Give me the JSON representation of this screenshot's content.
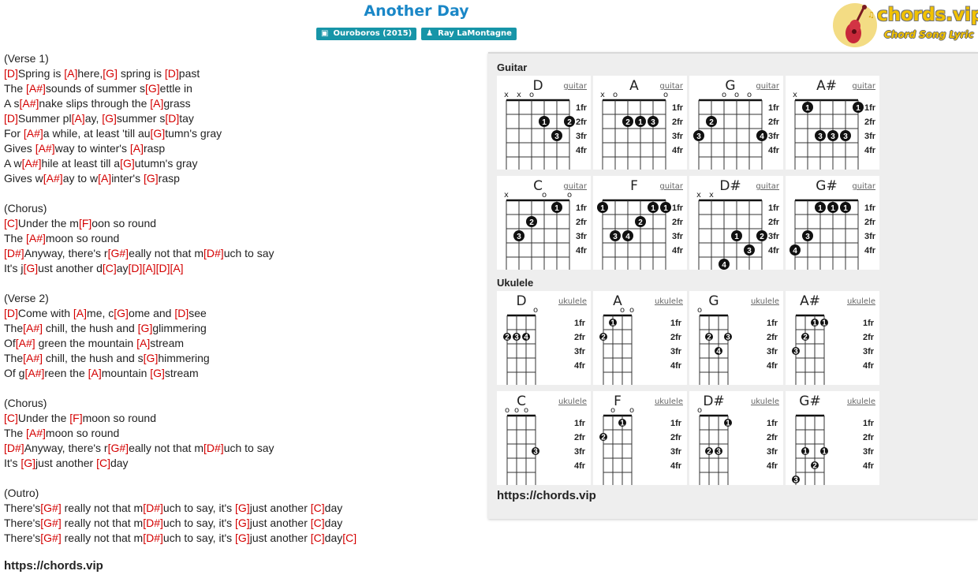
{
  "song": {
    "title": "Another Day",
    "album": "Ouroboros (2015)",
    "artist": "Ray LaMontagne",
    "album_icon": "book-icon",
    "artist_icon": "user-icon"
  },
  "logo": {
    "text": "chords.vip",
    "subtitle": "Chord Song Lyric",
    "icon": "guitar-icon"
  },
  "lyrics": [
    [
      {
        "t": "(Verse 1)"
      }
    ],
    [
      {
        "c": "[D]"
      },
      {
        "t": "Spring is "
      },
      {
        "c": "[A]"
      },
      {
        "t": "here,"
      },
      {
        "c": "[G]"
      },
      {
        "t": " spring is "
      },
      {
        "c": "[D]"
      },
      {
        "t": "past"
      }
    ],
    [
      {
        "t": "The "
      },
      {
        "c": "[A#]"
      },
      {
        "t": "sounds of summer s"
      },
      {
        "c": "[G]"
      },
      {
        "t": "ettle in"
      }
    ],
    [
      {
        "t": "A s"
      },
      {
        "c": "[A#]"
      },
      {
        "t": "nake slips through the "
      },
      {
        "c": "[A]"
      },
      {
        "t": "grass"
      }
    ],
    [
      {
        "c": "[D]"
      },
      {
        "t": "Summer pl"
      },
      {
        "c": "[A]"
      },
      {
        "t": "ay, "
      },
      {
        "c": "[G]"
      },
      {
        "t": "summer s"
      },
      {
        "c": "[D]"
      },
      {
        "t": "tay"
      }
    ],
    [
      {
        "t": "For "
      },
      {
        "c": "[A#]"
      },
      {
        "t": "a while, at least 'till au"
      },
      {
        "c": "[G]"
      },
      {
        "t": "tumn's gray"
      }
    ],
    [
      {
        "t": "Gives "
      },
      {
        "c": "[A#]"
      },
      {
        "t": "way to winter's "
      },
      {
        "c": "[A]"
      },
      {
        "t": "rasp"
      }
    ],
    [
      {
        "t": "A w"
      },
      {
        "c": "[A#]"
      },
      {
        "t": "hile at least till a"
      },
      {
        "c": "[G]"
      },
      {
        "t": "utumn's gray"
      }
    ],
    [
      {
        "t": "Gives w"
      },
      {
        "c": "[A#]"
      },
      {
        "t": "ay to w"
      },
      {
        "c": "[A]"
      },
      {
        "t": "inter's "
      },
      {
        "c": "[G]"
      },
      {
        "t": "rasp"
      }
    ],
    [],
    [
      {
        "t": "(Chorus)"
      }
    ],
    [
      {
        "c": "[C]"
      },
      {
        "t": "Under the m"
      },
      {
        "c": "[F]"
      },
      {
        "t": "oon so round"
      }
    ],
    [
      {
        "t": "The "
      },
      {
        "c": "[A#]"
      },
      {
        "t": "moon so round"
      }
    ],
    [
      {
        "c": "[D#]"
      },
      {
        "t": "Anyway, there's r"
      },
      {
        "c": "[G#]"
      },
      {
        "t": "eally not that m"
      },
      {
        "c": "[D#]"
      },
      {
        "t": "uch to say"
      }
    ],
    [
      {
        "t": "It's j"
      },
      {
        "c": "[G]"
      },
      {
        "t": "ust another d"
      },
      {
        "c": "[C]"
      },
      {
        "t": "ay"
      },
      {
        "c": "[D]"
      },
      {
        "c": "[A]"
      },
      {
        "c": "[D]"
      },
      {
        "c": "[A]"
      }
    ],
    [],
    [
      {
        "t": "(Verse 2)"
      }
    ],
    [
      {
        "c": "[D]"
      },
      {
        "t": "Come with "
      },
      {
        "c": "[A]"
      },
      {
        "t": "me, c"
      },
      {
        "c": "[G]"
      },
      {
        "t": "ome and "
      },
      {
        "c": "[D]"
      },
      {
        "t": "see"
      }
    ],
    [
      {
        "t": "The"
      },
      {
        "c": "[A#]"
      },
      {
        "t": " chill, the hush and "
      },
      {
        "c": "[G]"
      },
      {
        "t": "glimmering"
      }
    ],
    [
      {
        "t": "Of"
      },
      {
        "c": "[A#]"
      },
      {
        "t": " green the mountain "
      },
      {
        "c": "[A]"
      },
      {
        "t": "stream"
      }
    ],
    [
      {
        "t": "The"
      },
      {
        "c": "[A#]"
      },
      {
        "t": " chill, the hush and s"
      },
      {
        "c": "[G]"
      },
      {
        "t": "himmering"
      }
    ],
    [
      {
        "t": "Of g"
      },
      {
        "c": "[A#]"
      },
      {
        "t": "reen the "
      },
      {
        "c": "[A]"
      },
      {
        "t": "mountain "
      },
      {
        "c": "[G]"
      },
      {
        "t": "stream"
      }
    ],
    [],
    [
      {
        "t": "(Chorus)"
      }
    ],
    [
      {
        "c": "[C]"
      },
      {
        "t": "Under the "
      },
      {
        "c": "[F]"
      },
      {
        "t": "moon so round"
      }
    ],
    [
      {
        "t": "The "
      },
      {
        "c": "[A#]"
      },
      {
        "t": "moon so round"
      }
    ],
    [
      {
        "c": "[D#]"
      },
      {
        "t": "Anyway, there's r"
      },
      {
        "c": "[G#]"
      },
      {
        "t": "eally not that m"
      },
      {
        "c": "[D#]"
      },
      {
        "t": "uch to say"
      }
    ],
    [
      {
        "t": "It's "
      },
      {
        "c": "[G]"
      },
      {
        "t": "just another "
      },
      {
        "c": "[C]"
      },
      {
        "t": "day"
      }
    ],
    [],
    [
      {
        "t": "(Outro)"
      }
    ],
    [
      {
        "t": "There's"
      },
      {
        "c": "[G#]"
      },
      {
        "t": " really not that m"
      },
      {
        "c": "[D#]"
      },
      {
        "t": "uch to say, it's "
      },
      {
        "c": "[G]"
      },
      {
        "t": "just another "
      },
      {
        "c": "[C]"
      },
      {
        "t": "day"
      }
    ],
    [
      {
        "t": "There's"
      },
      {
        "c": "[G#]"
      },
      {
        "t": " really not that m"
      },
      {
        "c": "[D#]"
      },
      {
        "t": "uch to say, it's "
      },
      {
        "c": "[G]"
      },
      {
        "t": "just another "
      },
      {
        "c": "[C]"
      },
      {
        "t": "day"
      }
    ],
    [
      {
        "t": "There's"
      },
      {
        "c": "[G#]"
      },
      {
        "t": " really not that m"
      },
      {
        "c": "[D#]"
      },
      {
        "t": "uch to say, it's "
      },
      {
        "c": "[G]"
      },
      {
        "t": "just another "
      },
      {
        "c": "[C]"
      },
      {
        "t": "day"
      },
      {
        "c": "[C]"
      }
    ]
  ],
  "site_url": "https://chords.vip",
  "panel": {
    "guitar_title": "Guitar",
    "ukulele_title": "Ukulele",
    "url": "https://chords.vip",
    "fret_labels": [
      "1fr",
      "2fr",
      "3fr",
      "4fr"
    ],
    "guitar": [
      {
        "name": "D",
        "link": "guitar",
        "markers": [
          "x",
          "x",
          "o",
          "",
          "",
          ""
        ],
        "dots": [
          [
            4,
            2,
            "1"
          ],
          [
            6,
            2,
            "2"
          ],
          [
            5,
            3,
            "3"
          ]
        ]
      },
      {
        "name": "A",
        "link": "guitar",
        "markers": [
          "x",
          "o",
          "",
          "",
          "",
          "o"
        ],
        "dots": [
          [
            3,
            2,
            "2"
          ],
          [
            4,
            2,
            "1"
          ],
          [
            5,
            2,
            "3"
          ]
        ]
      },
      {
        "name": "G",
        "link": "guitar",
        "markers": [
          "",
          "",
          "o",
          "o",
          "o",
          ""
        ],
        "dots": [
          [
            2,
            2,
            "2"
          ],
          [
            1,
            3,
            "3"
          ],
          [
            6,
            3,
            "4"
          ]
        ]
      },
      {
        "name": "A#",
        "link": "guitar",
        "markers": [
          "x",
          "",
          "",
          "",
          "",
          ""
        ],
        "dots": [
          [
            2,
            1,
            "1"
          ],
          [
            6,
            1,
            "1"
          ],
          [
            3,
            3,
            "3"
          ],
          [
            4,
            3,
            "3"
          ],
          [
            5,
            3,
            "3"
          ]
        ]
      },
      {
        "name": "C",
        "link": "guitar",
        "markers": [
          "x",
          "",
          "",
          "o",
          "",
          "o"
        ],
        "dots": [
          [
            5,
            1,
            "1"
          ],
          [
            3,
            2,
            "2"
          ],
          [
            2,
            3,
            "3"
          ]
        ]
      },
      {
        "name": "F",
        "link": "guitar",
        "markers": [
          "",
          "",
          "",
          "",
          "",
          ""
        ],
        "dots": [
          [
            1,
            1,
            "1"
          ],
          [
            5,
            1,
            "1"
          ],
          [
            6,
            1,
            "1"
          ],
          [
            4,
            2,
            "2"
          ],
          [
            2,
            3,
            "3"
          ],
          [
            3,
            3,
            "4"
          ]
        ]
      },
      {
        "name": "D#",
        "link": "guitar",
        "markers": [
          "x",
          "x",
          "",
          "",
          "",
          ""
        ],
        "dots": [
          [
            4,
            3,
            "1"
          ],
          [
            6,
            3,
            "2"
          ],
          [
            5,
            4,
            "3"
          ],
          [
            3,
            5,
            "4"
          ]
        ]
      },
      {
        "name": "G#",
        "link": "guitar",
        "markers": [
          "",
          "",
          "",
          "",
          "",
          ""
        ],
        "dots": [
          [
            3,
            1,
            "1"
          ],
          [
            4,
            1,
            "1"
          ],
          [
            5,
            1,
            "1"
          ],
          [
            2,
            3,
            "3"
          ],
          [
            1,
            4,
            "4"
          ]
        ]
      }
    ],
    "ukulele": [
      {
        "name": "D",
        "link": "ukulele",
        "markers": [
          "",
          "",
          "",
          "o"
        ],
        "dots": [
          [
            1,
            2,
            "2"
          ],
          [
            2,
            2,
            "3"
          ],
          [
            3,
            2,
            "4"
          ]
        ]
      },
      {
        "name": "A",
        "link": "ukulele",
        "markers": [
          "",
          "",
          "o",
          "o"
        ],
        "dots": [
          [
            2,
            1,
            "1"
          ],
          [
            1,
            2,
            "2"
          ]
        ]
      },
      {
        "name": "G",
        "link": "ukulele",
        "markers": [
          "o",
          "",
          "",
          ""
        ],
        "dots": [
          [
            2,
            2,
            "2"
          ],
          [
            4,
            2,
            "3"
          ],
          [
            3,
            3,
            "4"
          ]
        ]
      },
      {
        "name": "A#",
        "link": "ukulele",
        "markers": [
          "",
          "",
          "",
          ""
        ],
        "dots": [
          [
            3,
            1,
            "1"
          ],
          [
            4,
            1,
            "1"
          ],
          [
            2,
            2,
            "2"
          ],
          [
            1,
            3,
            "3"
          ]
        ]
      },
      {
        "name": "C",
        "link": "ukulele",
        "markers": [
          "o",
          "o",
          "o",
          ""
        ],
        "dots": [
          [
            4,
            3,
            "3"
          ]
        ]
      },
      {
        "name": "F",
        "link": "ukulele",
        "markers": [
          "",
          "o",
          "",
          "o"
        ],
        "dots": [
          [
            3,
            1,
            "1"
          ],
          [
            1,
            2,
            "2"
          ]
        ]
      },
      {
        "name": "D#",
        "link": "ukulele",
        "markers": [
          "o",
          "",
          "",
          ""
        ],
        "dots": [
          [
            4,
            1,
            "1"
          ],
          [
            2,
            3,
            "2"
          ],
          [
            3,
            3,
            "3"
          ]
        ]
      },
      {
        "name": "G#",
        "link": "ukulele",
        "markers": [
          "",
          "",
          "",
          ""
        ],
        "dots": [
          [
            2,
            3,
            "1"
          ],
          [
            4,
            3,
            "1"
          ],
          [
            3,
            4,
            "2"
          ],
          [
            1,
            5,
            "3"
          ]
        ]
      }
    ]
  }
}
